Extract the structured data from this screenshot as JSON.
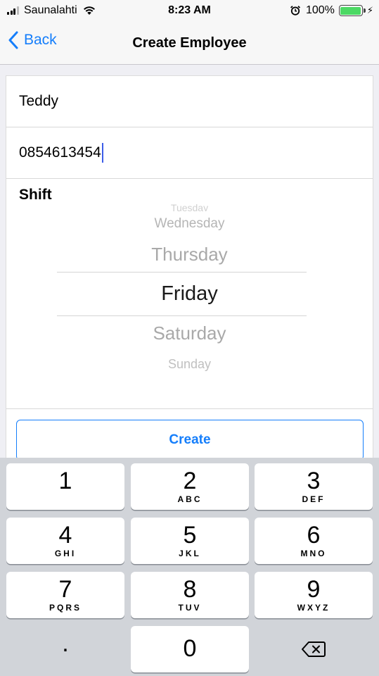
{
  "status_bar": {
    "carrier": "Saunalahti",
    "time": "8:23 AM",
    "battery_percent": "100%",
    "battery_level": 1.0,
    "signal_bars": 3,
    "icons": [
      "signal-icon",
      "wifi-icon",
      "alarm-icon",
      "battery-icon",
      "charging-icon"
    ]
  },
  "nav": {
    "back_label": "Back",
    "title": "Create Employee"
  },
  "form": {
    "name_value": "Teddy",
    "phone_value": "0854613454",
    "shift_label": "Shift"
  },
  "picker": {
    "options": [
      "Tuesday",
      "Wednesday",
      "Thursday",
      "Friday",
      "Saturday",
      "Sunday"
    ],
    "selected": "Friday"
  },
  "create_button": "Create",
  "keypad": {
    "keys": [
      {
        "digit": "1",
        "letters": ""
      },
      {
        "digit": "2",
        "letters": "ABC"
      },
      {
        "digit": "3",
        "letters": "DEF"
      },
      {
        "digit": "4",
        "letters": "GHI"
      },
      {
        "digit": "5",
        "letters": "JKL"
      },
      {
        "digit": "6",
        "letters": "MNO"
      },
      {
        "digit": "7",
        "letters": "PQRS"
      },
      {
        "digit": "8",
        "letters": "TUV"
      },
      {
        "digit": "9",
        "letters": "WXYZ"
      },
      {
        "digit": "0",
        "letters": ""
      }
    ],
    "dot": ".",
    "delete_icon": "backspace-icon"
  },
  "colors": {
    "accent": "#157efb",
    "battery": "#4cd964",
    "cursor": "#3c5de8"
  }
}
